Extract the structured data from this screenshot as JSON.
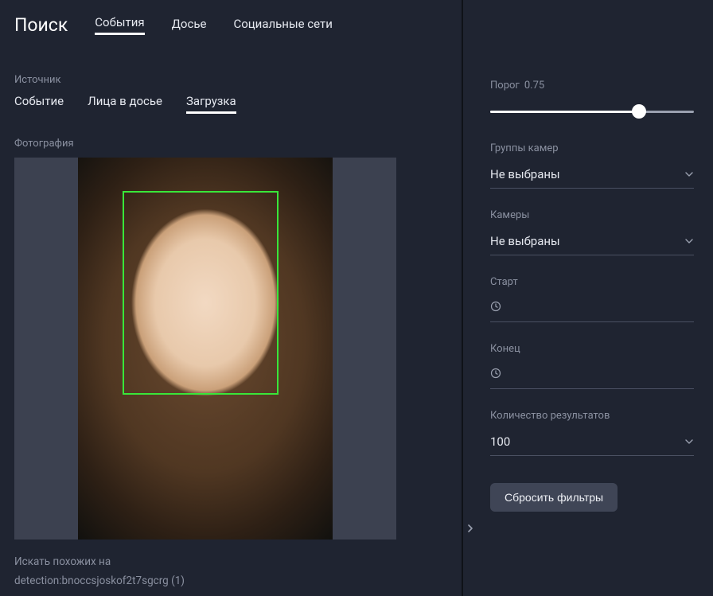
{
  "header": {
    "title": "Поиск",
    "tabs": [
      {
        "label": "События",
        "active": true
      },
      {
        "label": "Досье",
        "active": false
      },
      {
        "label": "Социальные сети",
        "active": false
      }
    ]
  },
  "source": {
    "label": "Источник",
    "tabs": [
      {
        "label": "Событие",
        "active": false
      },
      {
        "label": "Лица в досье",
        "active": false
      },
      {
        "label": "Загрузка",
        "active": true
      }
    ]
  },
  "photo": {
    "label": "Фотография"
  },
  "similar": {
    "label": "Искать похожих на",
    "value": "detection:bnoccsjoskof2t7sgcrg (1)"
  },
  "filters": {
    "threshold": {
      "label": "Порог",
      "value": "0.75",
      "fraction": 0.73
    },
    "camera_groups": {
      "label": "Группы камер",
      "value": "Не выбраны"
    },
    "cameras": {
      "label": "Камеры",
      "value": "Не выбраны"
    },
    "start": {
      "label": "Старт",
      "value": ""
    },
    "end": {
      "label": "Конец",
      "value": ""
    },
    "result_count": {
      "label": "Количество результатов",
      "value": "100"
    },
    "reset": "Сбросить фильтры"
  }
}
